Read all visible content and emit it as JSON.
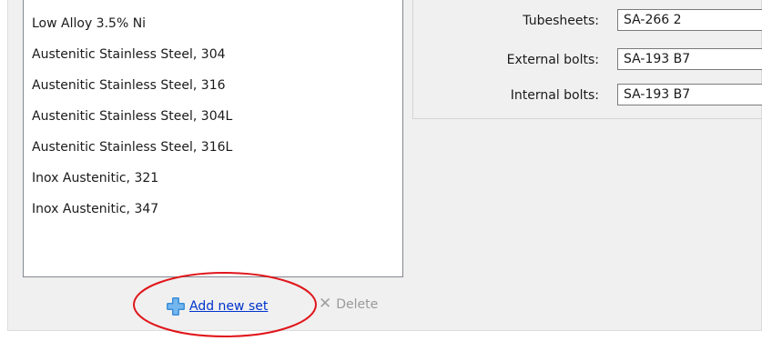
{
  "materials_list": {
    "items": [
      "Low Alloy 3.5% Ni",
      "Austenitic Stainless Steel, 304",
      "Austenitic Stainless Steel, 316",
      "Austenitic Stainless Steel, 304L",
      "Austenitic Stainless Steel, 316L",
      "Inox Austenitic, 321",
      "Inox Austenitic, 347"
    ]
  },
  "properties": [
    {
      "label": "Tubesheets:",
      "value": "SA-266 2"
    },
    {
      "label": "External bolts:",
      "value": "SA-193 B7"
    },
    {
      "label": "Internal bolts:",
      "value": "SA-193 B7"
    }
  ],
  "actions": {
    "add_label": "Add new set",
    "delete_label": "Delete"
  },
  "colors": {
    "link": "#0033cc",
    "add_icon": "#3b8ed8",
    "highlight": "#e0161b"
  }
}
